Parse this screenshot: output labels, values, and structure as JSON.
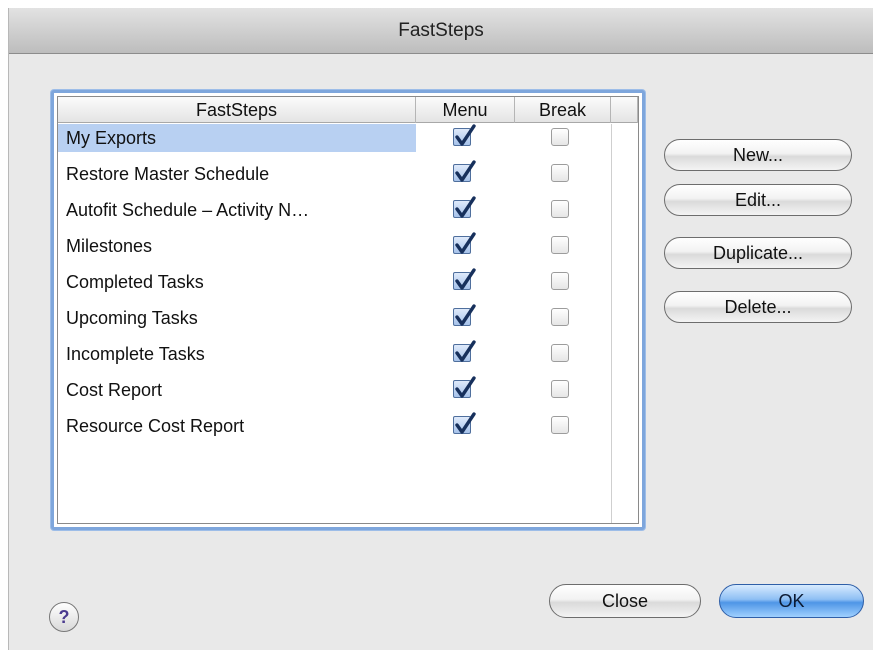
{
  "window": {
    "title": "FastSteps"
  },
  "table": {
    "columns": {
      "name": "FastSteps",
      "menu": "Menu",
      "break": "Break"
    },
    "rows": [
      {
        "name": "My Exports",
        "menu": true,
        "break": false,
        "selected": true
      },
      {
        "name": "Restore Master Schedule",
        "menu": true,
        "break": false
      },
      {
        "name": "Autofit Schedule – Activity N…",
        "menu": true,
        "break": false
      },
      {
        "name": "Milestones",
        "menu": true,
        "break": false
      },
      {
        "name": "Completed Tasks",
        "menu": true,
        "break": false
      },
      {
        "name": "Upcoming Tasks",
        "menu": true,
        "break": false
      },
      {
        "name": "Incomplete Tasks",
        "menu": true,
        "break": false
      },
      {
        "name": "Cost Report",
        "menu": true,
        "break": false
      },
      {
        "name": "Resource Cost Report",
        "menu": true,
        "break": false
      }
    ]
  },
  "buttons": {
    "new": "New...",
    "edit": "Edit...",
    "duplicate": "Duplicate...",
    "delete": "Delete...",
    "close": "Close",
    "ok": "OK",
    "help": "?"
  },
  "colors": {
    "selection": "#b8d0f2",
    "focus_ring": "#7ea6dc",
    "default_button": "#4e95e6"
  }
}
